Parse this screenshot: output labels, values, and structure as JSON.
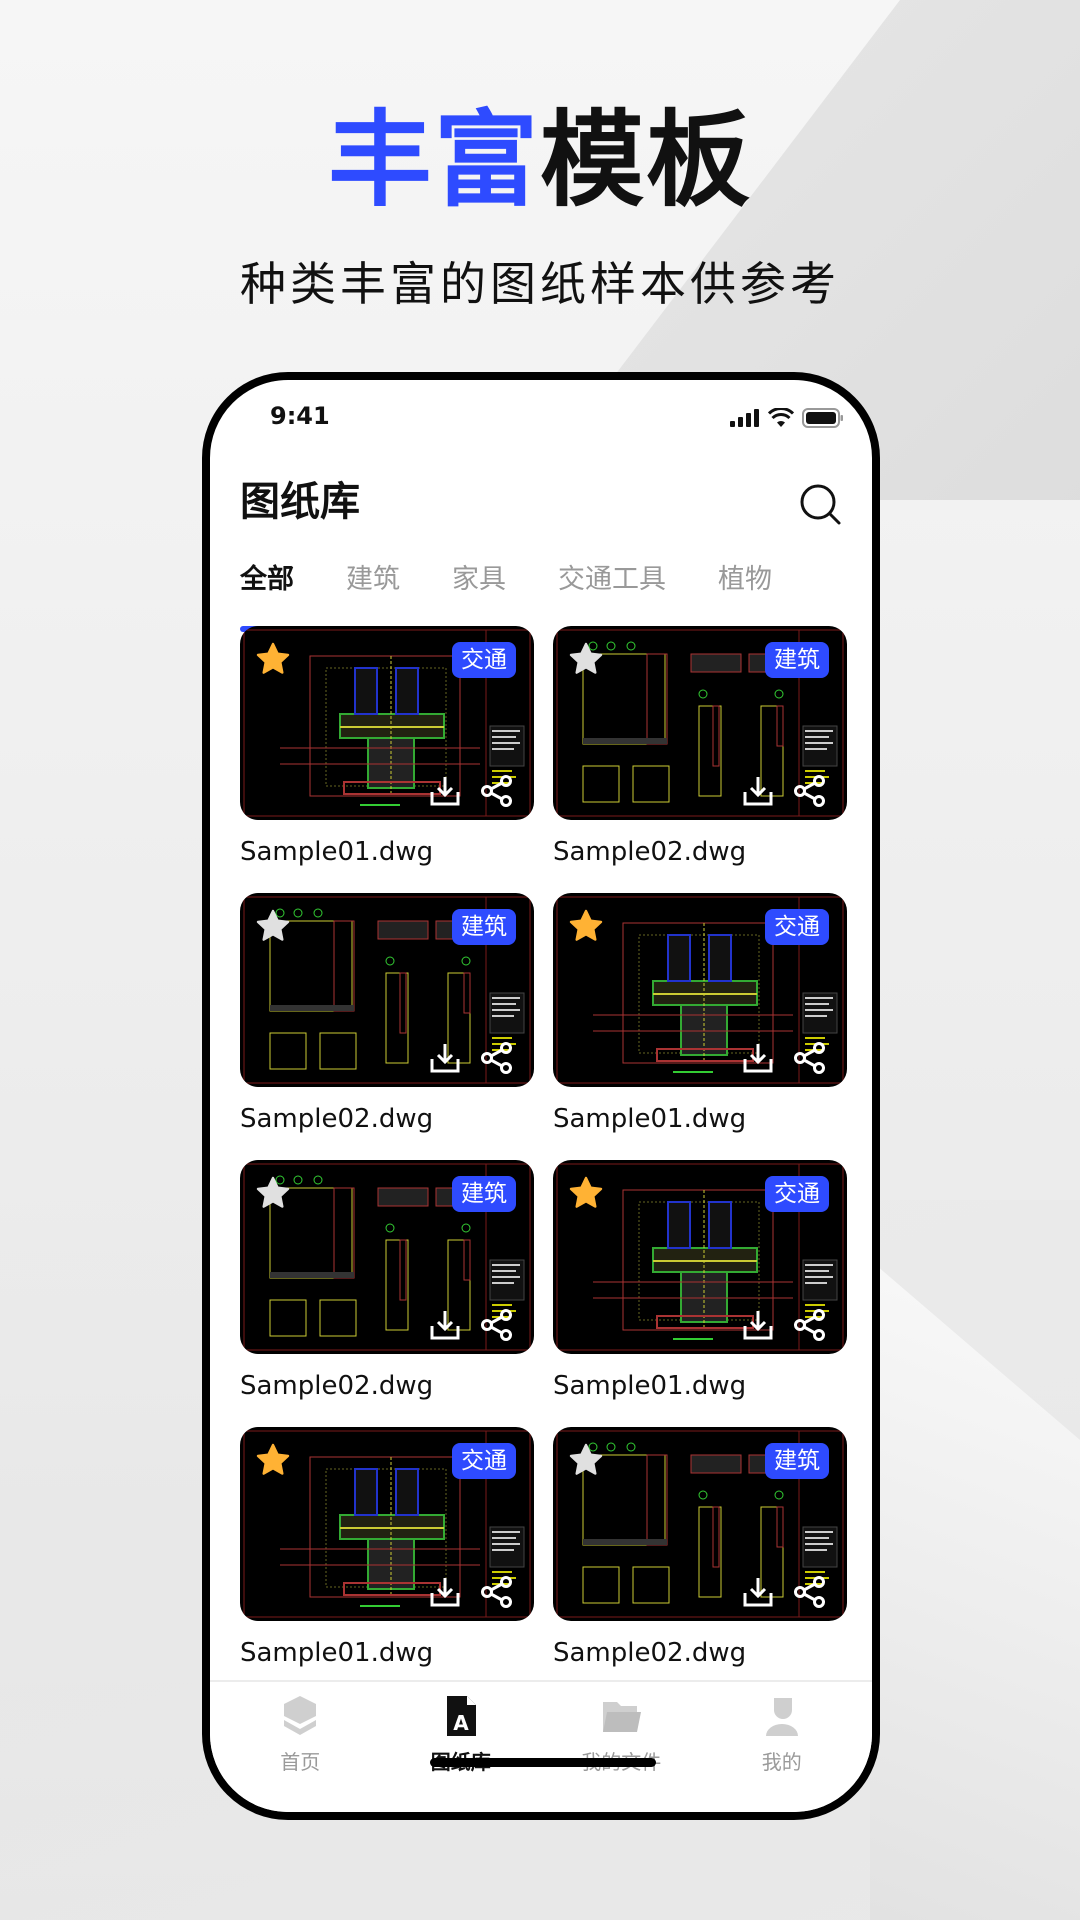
{
  "hero": {
    "title_blue": "丰富",
    "title_black": "模板",
    "subtitle": "种类丰富的图纸样本供参考"
  },
  "status_bar": {
    "time": "9:41"
  },
  "header": {
    "title": "图纸库",
    "search_icon": "search-icon"
  },
  "tabs": [
    {
      "label": "全部",
      "active": true
    },
    {
      "label": "建筑",
      "active": false
    },
    {
      "label": "家具",
      "active": false
    },
    {
      "label": "交通工具",
      "active": false
    },
    {
      "label": "植物",
      "active": false
    }
  ],
  "items": [
    {
      "name": "Sample01.dwg",
      "tag": "交通",
      "starred": true,
      "variant": "a"
    },
    {
      "name": "Sample02.dwg",
      "tag": "建筑",
      "starred": false,
      "variant": "b"
    },
    {
      "name": "Sample02.dwg",
      "tag": "建筑",
      "starred": false,
      "variant": "b"
    },
    {
      "name": "Sample01.dwg",
      "tag": "交通",
      "starred": true,
      "variant": "a"
    },
    {
      "name": "Sample02.dwg",
      "tag": "建筑",
      "starred": false,
      "variant": "b"
    },
    {
      "name": "Sample01.dwg",
      "tag": "交通",
      "starred": true,
      "variant": "a"
    },
    {
      "name": "Sample01.dwg",
      "tag": "交通",
      "starred": true,
      "variant": "a"
    },
    {
      "name": "Sample02.dwg",
      "tag": "建筑",
      "starred": false,
      "variant": "b"
    }
  ],
  "tabbar": [
    {
      "label": "首页",
      "icon": "layers-icon",
      "active": false
    },
    {
      "label": "图纸库",
      "icon": "drawing-file-icon",
      "active": true
    },
    {
      "label": "我的文件",
      "icon": "folder-icon",
      "active": false
    },
    {
      "label": "我的",
      "icon": "user-icon",
      "active": false
    }
  ],
  "colors": {
    "accent": "#2e4bff",
    "star_on": "#ffb234",
    "star_off": "#e0e0e0",
    "tab_inactive": "#999999"
  }
}
